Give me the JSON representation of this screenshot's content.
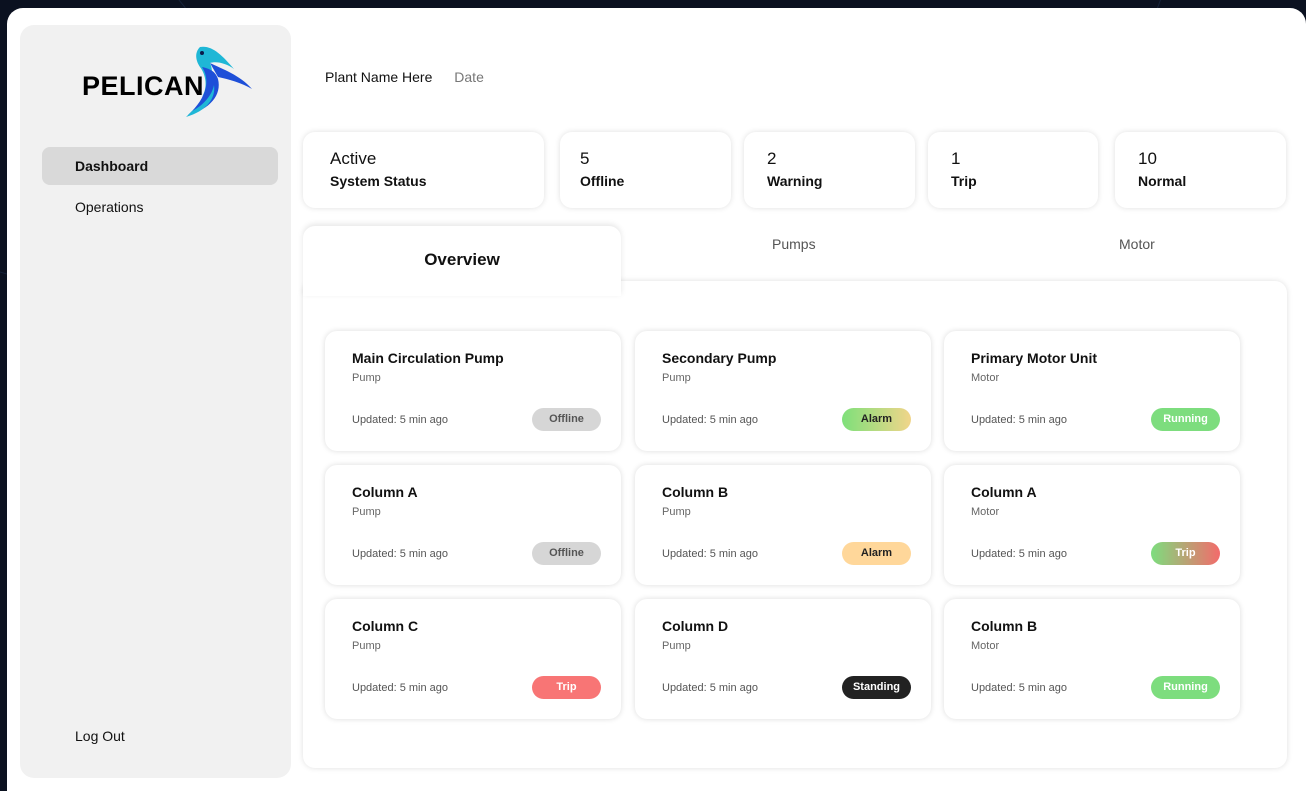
{
  "brand": {
    "name": "PELICAN"
  },
  "sidebar": {
    "items": [
      {
        "label": "Dashboard",
        "active": true
      },
      {
        "label": "Operations",
        "active": false
      }
    ],
    "logout_label": "Log Out"
  },
  "header": {
    "plant_name": "Plant Name Here",
    "date": "Date"
  },
  "stats": [
    {
      "value": "Active",
      "label": "System Status"
    },
    {
      "value": "5",
      "label": "Offline"
    },
    {
      "value": "2",
      "label": "Warning"
    },
    {
      "value": "1",
      "label": "Trip"
    },
    {
      "value": "10",
      "label": "Normal"
    }
  ],
  "tabs": [
    {
      "label": "Overview",
      "active": true
    },
    {
      "label": "Pumps",
      "active": false
    },
    {
      "label": "Motor",
      "active": false
    }
  ],
  "equipment": [
    {
      "name": "Main Circulation Pump",
      "type": "Pump",
      "updated": "Updated: 5 min ago",
      "status": "Offline"
    },
    {
      "name": "Secondary Pump",
      "type": "Pump",
      "updated": "Updated: 5 min ago",
      "status": "Alarm"
    },
    {
      "name": "Primary Motor Unit",
      "type": "Motor",
      "updated": "Updated: 5 min ago",
      "status": "Running"
    },
    {
      "name": "Column A",
      "type": "Pump",
      "updated": "Updated: 5 min ago",
      "status": "Offline"
    },
    {
      "name": "Column B",
      "type": "Pump",
      "updated": "Updated: 5 min ago",
      "status": "Alarm"
    },
    {
      "name": "Column A",
      "type": "Motor",
      "updated": "Updated: 5 min ago",
      "status": "Trip"
    },
    {
      "name": "Column C",
      "type": "Pump",
      "updated": "Updated: 5 min ago",
      "status": "Trip"
    },
    {
      "name": "Column D",
      "type": "Pump",
      "updated": "Updated: 5 min ago",
      "status": "Standing"
    },
    {
      "name": "Column B",
      "type": "Motor",
      "updated": "Updated: 5 min ago",
      "status": "Running"
    }
  ],
  "colors": {
    "offline": "#d6d6d6",
    "alarm": "#ffd79a",
    "running": "#7ddd7e",
    "trip": "#f87575",
    "standing": "#222222",
    "logo_blue": "#1e4fd8",
    "logo_cyan": "#1fb7d6"
  }
}
